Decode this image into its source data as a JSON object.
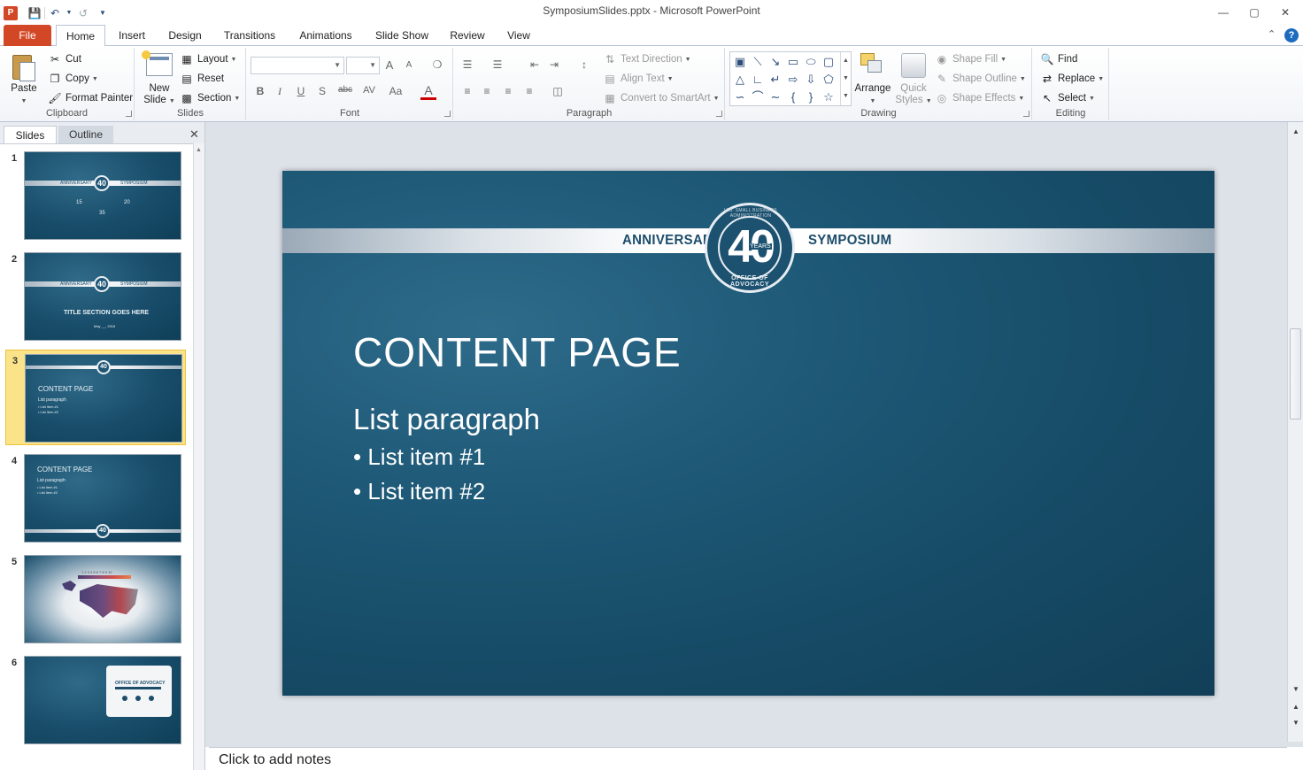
{
  "window": {
    "title": "SymposiumSlides.pptx  -  Microsoft PowerPoint",
    "app_icon_letter": "P"
  },
  "tabs": [
    "File",
    "Home",
    "Insert",
    "Design",
    "Transitions",
    "Animations",
    "Slide Show",
    "Review",
    "View"
  ],
  "ribbon": {
    "clipboard": {
      "label": "Clipboard",
      "paste": "Paste",
      "cut": "Cut",
      "copy": "Copy",
      "format_painter": "Format Painter"
    },
    "slides": {
      "label": "Slides",
      "new_slide_line1": "New",
      "new_slide_line2": "Slide",
      "layout": "Layout",
      "reset": "Reset",
      "section": "Section"
    },
    "font": {
      "label": "Font",
      "bold": "B",
      "italic": "I",
      "underline": "U",
      "shadow": "S",
      "strikethrough": "abc",
      "spacing": "AV",
      "case": "Aa",
      "color": "A",
      "grow": "A",
      "shrink": "A"
    },
    "paragraph": {
      "label": "Paragraph",
      "text_direction": "Text Direction",
      "align_text": "Align Text",
      "convert_smartart": "Convert to SmartArt"
    },
    "drawing": {
      "label": "Drawing",
      "arrange": "Arrange",
      "quick_styles_line1": "Quick",
      "quick_styles_line2": "Styles",
      "shape_fill": "Shape Fill",
      "shape_outline": "Shape Outline",
      "shape_effects": "Shape Effects"
    },
    "editing": {
      "label": "Editing",
      "find": "Find",
      "replace": "Replace",
      "select": "Select"
    }
  },
  "pane": {
    "tab_slides": "Slides",
    "tab_outline": "Outline",
    "thumbnails": [
      {
        "num": "1",
        "band_left": "ANNIVERSARY",
        "band_right": "SYMPOSIUM",
        "badge": "40",
        "stats": [
          "15",
          "20",
          "35"
        ]
      },
      {
        "num": "2",
        "band_left": "ANNIVERSARY",
        "band_right": "SYMPOSIUM",
        "badge": "40",
        "title": "TITLE SECTION GOES HERE",
        "date": "May __, 2016"
      },
      {
        "num": "3",
        "badge": "40",
        "title": "CONTENT PAGE",
        "sub": "List paragraph",
        "items": [
          "• List item #1",
          "• List item #2"
        ]
      },
      {
        "num": "4",
        "badge": "40",
        "title": "CONTENT PAGE",
        "sub": "List paragraph",
        "items": [
          "• List item #1",
          "• List item #2"
        ]
      },
      {
        "num": "5",
        "scale": "1 2 3 4 5 6 7 8 9 10"
      },
      {
        "num": "6",
        "card_text": "OFFICE OF ADVOCACY"
      }
    ]
  },
  "slide": {
    "band_left": "ANNIVERSARY",
    "band_right": "SYMPOSIUM",
    "seal_number": "40",
    "seal_years": "YEARS",
    "seal_bottom": "OFFICE OF ADVOCACY",
    "seal_top": "U.S. SMALL BUSINESS ADMINISTRATION",
    "title": "CONTENT PAGE",
    "subtitle": "List paragraph",
    "items": [
      "• List item #1",
      "• List item #2"
    ]
  },
  "notes": {
    "placeholder": "Click to add notes"
  },
  "colors": {
    "file_tab": "#d24726",
    "slide_bg": "#1d5876",
    "selected_thumb": "#fbe38a"
  }
}
